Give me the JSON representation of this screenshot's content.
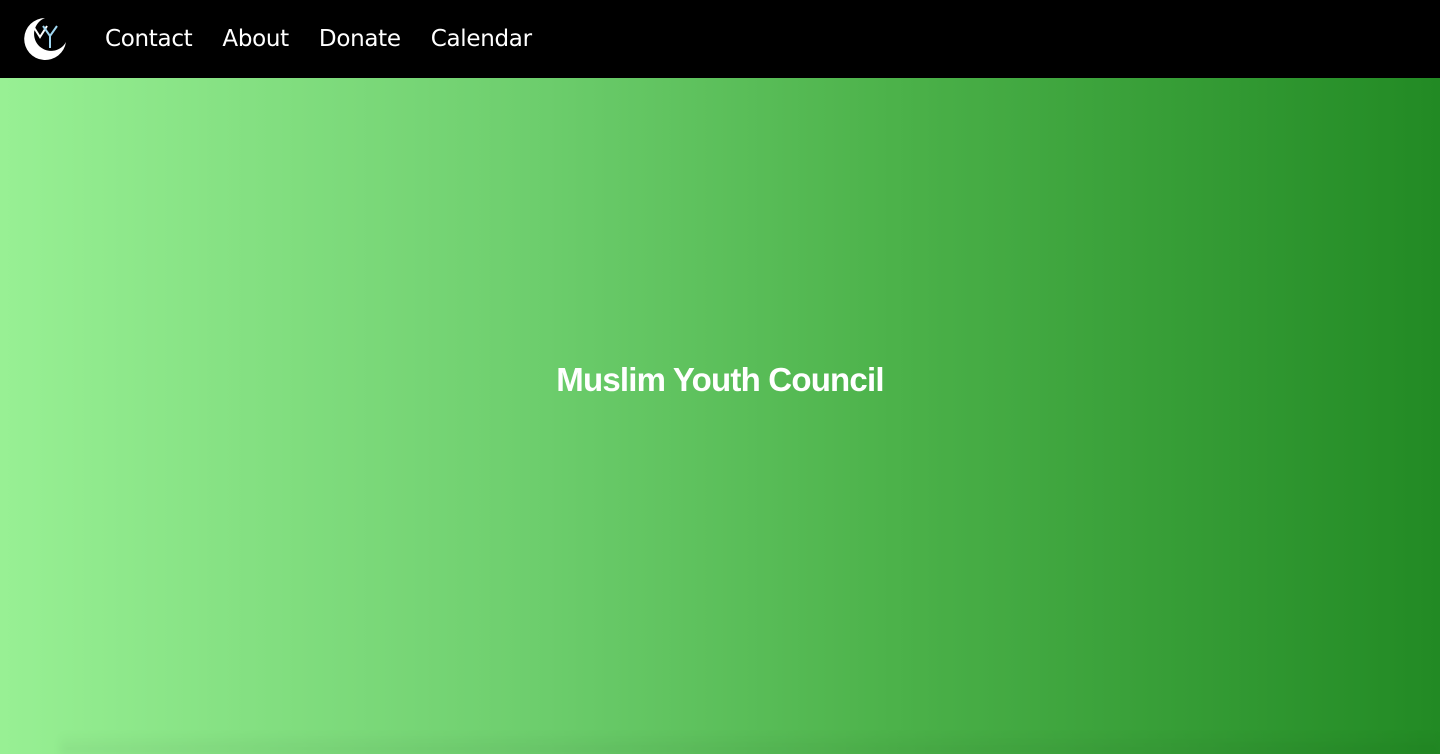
{
  "nav": {
    "logo_icon": "myc-crescent-logo-icon",
    "logo_text": "MY",
    "links": [
      {
        "label": "Contact"
      },
      {
        "label": "About"
      },
      {
        "label": "Donate"
      },
      {
        "label": "Calendar"
      }
    ]
  },
  "hero": {
    "title": "Muslim Youth Council"
  },
  "colors": {
    "navbar_bg": "#000000",
    "gradient_start": "#98f094",
    "gradient_end": "#228a24",
    "text": "#ffffff"
  }
}
